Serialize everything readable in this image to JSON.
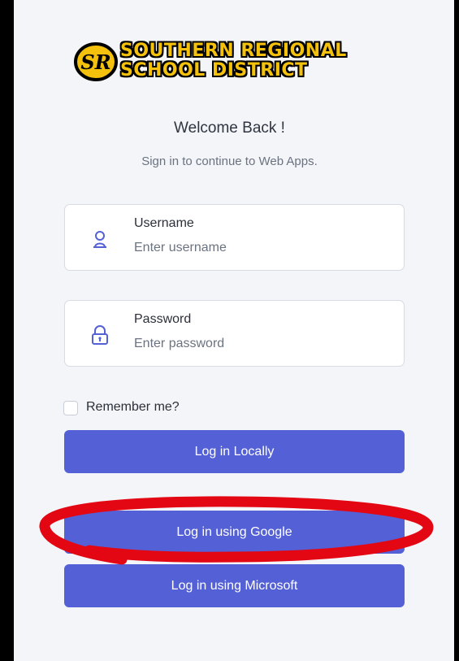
{
  "logo": {
    "badge_text": "SR",
    "line1": "SOUTHERN REGIONAL",
    "line2": "SCHOOL DISTRICT"
  },
  "header": {
    "title": "Welcome Back !",
    "subtitle": "Sign in to continue to Web Apps."
  },
  "username": {
    "label": "Username",
    "placeholder": "Enter username",
    "icon": "user-icon"
  },
  "password": {
    "label": "Password",
    "placeholder": "Enter password",
    "icon": "lock-icon"
  },
  "remember": {
    "label": "Remember me?",
    "checked": false
  },
  "buttons": {
    "local": "Log in Locally",
    "google": "Log in using Google",
    "microsoft": "Log in using Microsoft"
  },
  "colors": {
    "accent": "#5460d6",
    "panel": "#f3f5f8",
    "logo_yellow": "#f4c20d",
    "annotation": "#e30613"
  }
}
